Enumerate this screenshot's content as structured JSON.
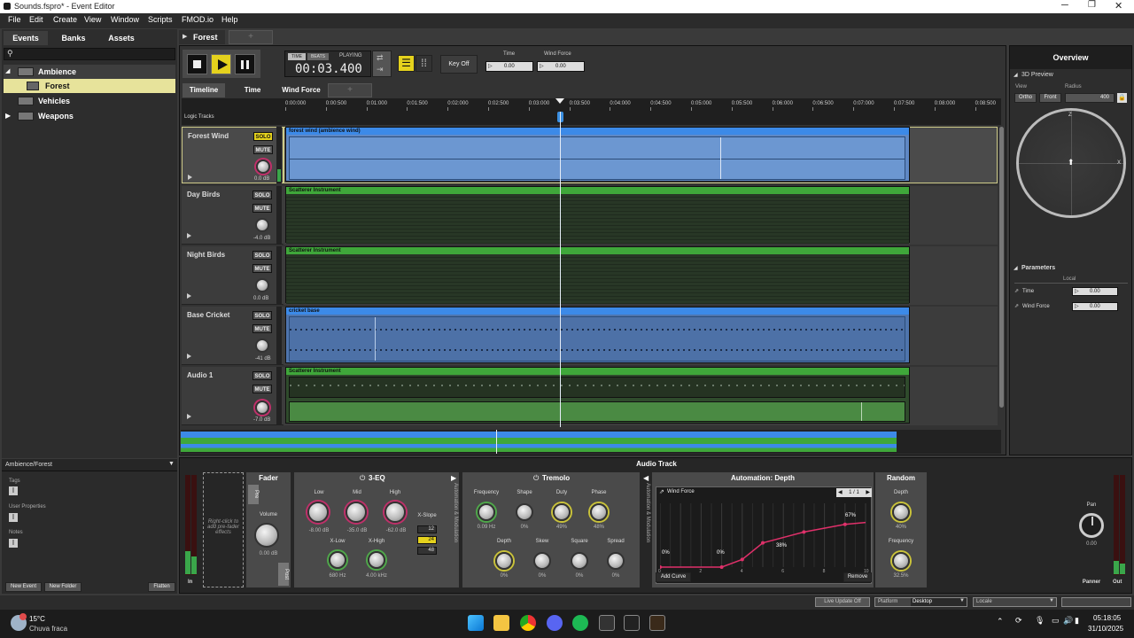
{
  "window": {
    "title": "Sounds.fspro* - Event Editor"
  },
  "menu": [
    "File",
    "Edit",
    "Create",
    "View",
    "Window",
    "Scripts",
    "FMOD.io",
    "Help"
  ],
  "browser": {
    "tabs": [
      "Events",
      "Banks",
      "Assets"
    ],
    "tree": [
      {
        "label": "Ambience",
        "level": 0,
        "expanded": true
      },
      {
        "label": "Forest",
        "level": 1,
        "selected": true
      },
      {
        "label": "Vehicles",
        "level": 0
      },
      {
        "label": "Weapons",
        "level": 0
      }
    ],
    "path": "Ambience/Forest",
    "sections": [
      "Tags",
      "User Properties",
      "Notes"
    ],
    "buttons": {
      "new_event": "New Event",
      "new_folder": "New Folder",
      "flatten": "Flatten"
    }
  },
  "event": {
    "tab": "Forest",
    "transport": {
      "time_label": "TIME",
      "beats_label": "BEATS",
      "status": "PLAYING",
      "time": "00:03.400",
      "key_off": "Key Off"
    },
    "params": [
      {
        "label": "Time",
        "value": "0.00"
      },
      {
        "label": "Wind Force",
        "value": "0.00"
      }
    ],
    "sheet_tabs": [
      "Timeline",
      "Time",
      "Wind Force"
    ],
    "logic_tracks": "Logic Tracks",
    "ruler": [
      "0:00:000",
      "0:00:500",
      "0:01:000",
      "0:01:500",
      "0:02:000",
      "0:02:500",
      "0:03:000",
      "0:03:500",
      "0:04:000",
      "0:04:500",
      "0:05:000",
      "0:05:500",
      "0:06:000",
      "0:06:500",
      "0:07:000",
      "0:07:500",
      "0:08:000",
      "0:08:500"
    ],
    "tracks": [
      {
        "name": "Forest Wind",
        "db": "0.0 dB",
        "instrument": "forest wind (ambience wind)",
        "color": "blue"
      },
      {
        "name": "Day Birds",
        "db": "-4.0 dB",
        "instrument": "Scatterer Instrument",
        "color": "green"
      },
      {
        "name": "Night Birds",
        "db": "0.0 dB",
        "instrument": "Scatterer Instrument",
        "color": "green"
      },
      {
        "name": "Base Cricket",
        "db": "-41 dB",
        "instrument": "cricket base",
        "color": "blue"
      },
      {
        "name": "Audio 1",
        "db": "-7.0 dB",
        "instrument": "Scatterer Instrument",
        "color": "green"
      }
    ],
    "solo": "SOLO",
    "mute": "MUTE"
  },
  "overview": {
    "title": "Overview",
    "preview": "3D Preview",
    "view_label": "View",
    "ortho": "Ortho",
    "front": "Front",
    "radius_label": "Radius",
    "radius": "400",
    "axis_z": "Z",
    "axis_x": "X",
    "parameters": "Parameters",
    "local": "Local",
    "params": [
      {
        "label": "Time",
        "value": "0.00"
      },
      {
        "label": "Wind Force",
        "value": "0.00"
      }
    ]
  },
  "deck": {
    "title": "Audio Track",
    "input_label": "In",
    "output_label": "Out",
    "prefader_hint": "Right-click to add pre-fader effects",
    "fader": {
      "title": "Fader",
      "pre": "Pre",
      "post": "Post",
      "volume": "Volume",
      "volume_value": "0.00 dB"
    },
    "eq": {
      "title": "3-EQ",
      "low": "Low",
      "mid": "Mid",
      "high": "High",
      "low_val": "-8.00 dB",
      "mid_val": "-35.0 dB",
      "high_val": "-62.0 dB",
      "xlow": "X-Low",
      "xhigh": "X-High",
      "xlow_val": "680 Hz",
      "xhigh_val": "4.00 kHz",
      "xslope": "X-Slope",
      "slopes": [
        "12",
        "24",
        "48"
      ]
    },
    "automation_label": "Automation & Modulation",
    "tremolo": {
      "title": "Tremolo",
      "frequency": "Frequency",
      "shape": "Shape",
      "duty": "Duty",
      "phase": "Phase",
      "freq_val": "0.09 Hz",
      "shape_val": "0%",
      "duty_val": "49%",
      "phase_val": "48%",
      "depth": "Depth",
      "skew": "Skew",
      "square": "Square",
      "spread": "Spread",
      "depth_val": "0%",
      "skew_val": "0%",
      "square_val": "0%",
      "spread_val": "0%"
    },
    "auto": {
      "title": "Automation: Depth",
      "param": "Wind Force",
      "page": "1 / 1",
      "points": [
        "0%",
        "0%",
        "38%",
        "67%"
      ],
      "x_ticks": [
        "0",
        "2",
        "4",
        "6",
        "8",
        "10"
      ],
      "add": "Add Curve",
      "remove": "Remove"
    },
    "random": {
      "title": "Random",
      "depth": "Depth",
      "depth_val": "40%",
      "frequency": "Frequency",
      "freq_val": "32.5%"
    },
    "pan": {
      "label": "Pan",
      "value": "0.00",
      "panner": "Panner"
    }
  },
  "statusbar": {
    "live_update": "Live Update Off",
    "platform_label": "Platform",
    "platform": "Desktop",
    "locale": "Locale"
  },
  "taskbar": {
    "temp": "15°C",
    "weather": "Chuva fraca",
    "time": "05:18:05",
    "date": "31/10/2025"
  },
  "automation_curve": {
    "x": [
      0,
      3,
      4,
      5,
      7,
      9,
      10
    ],
    "y": [
      0,
      0,
      0.12,
      0.38,
      0.55,
      0.67,
      0.7
    ]
  }
}
